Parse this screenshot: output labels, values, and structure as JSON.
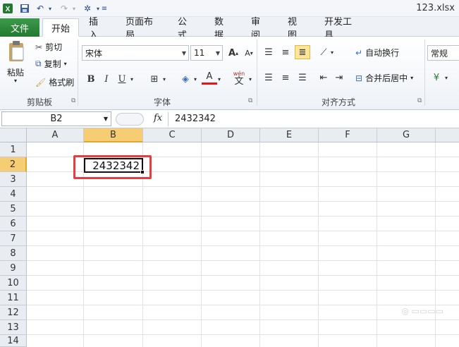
{
  "window": {
    "title": "123.xlsx"
  },
  "quick_access": {
    "save_icon": "save-icon",
    "undo_icon": "undo-icon",
    "redo_icon": "redo-icon"
  },
  "tabs": [
    {
      "label": "文件"
    },
    {
      "label": "开始"
    },
    {
      "label": "插入"
    },
    {
      "label": "页面布局"
    },
    {
      "label": "公式"
    },
    {
      "label": "数据"
    },
    {
      "label": "审阅"
    },
    {
      "label": "视图"
    },
    {
      "label": "开发工具"
    }
  ],
  "clipboard": {
    "paste": "粘贴",
    "cut": "剪切",
    "copy": "复制",
    "format_painter": "格式刷",
    "group": "剪贴板"
  },
  "font": {
    "name": "宋体",
    "size": "11",
    "group": "字体",
    "bold": "B",
    "italic": "I",
    "underline": "U",
    "grow": "A",
    "shrink": "A",
    "font_color": "A",
    "phonetic": "wén",
    "phonetic_char": "文"
  },
  "alignment": {
    "wrap": "自动换行",
    "merge": "合并后居中",
    "group": "对齐方式"
  },
  "number": {
    "format": "常规"
  },
  "formula_bar": {
    "name_box": "B2",
    "fx": "fx",
    "value": "2432342"
  },
  "grid": {
    "columns": [
      "A",
      "B",
      "C",
      "D",
      "E",
      "F",
      "G"
    ],
    "rows": [
      "1",
      "2",
      "3",
      "4",
      "5",
      "6",
      "7",
      "8",
      "9",
      "10",
      "11",
      "12",
      "13",
      "14"
    ],
    "selected_cell_value": "2432342"
  },
  "colors": {
    "file_tab": "#217a2f",
    "highlight": "#e0403f",
    "selected_header": "#f7cd73"
  }
}
